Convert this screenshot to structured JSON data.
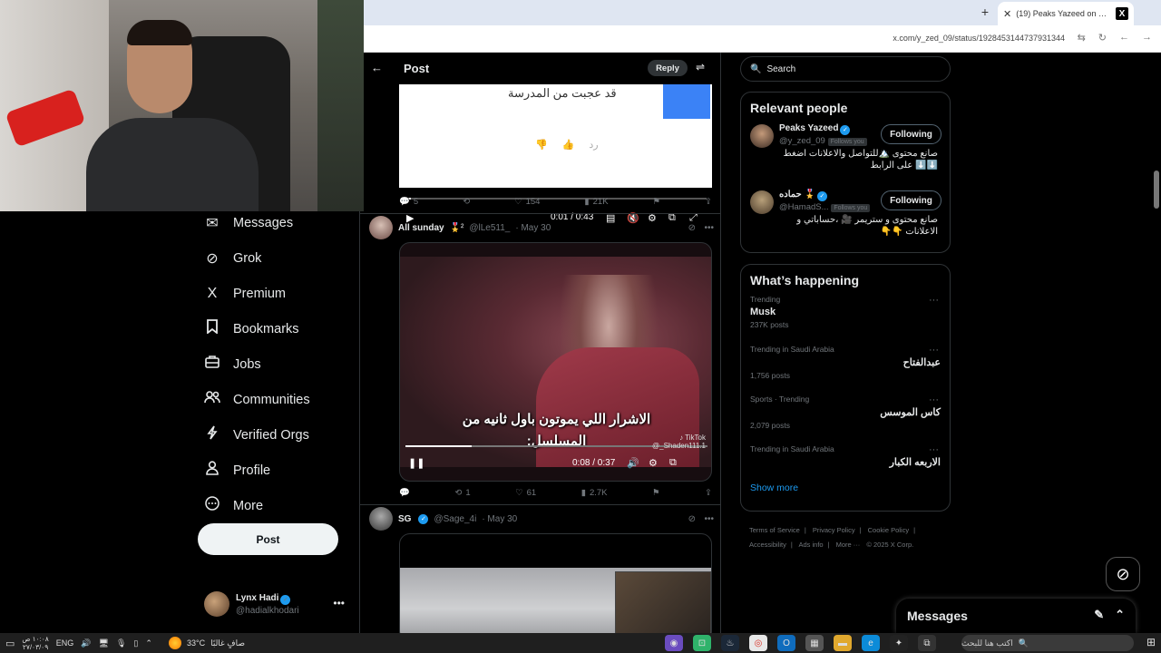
{
  "browser": {
    "tab_title": "(19) Peaks Yazeed on X: \"ا...",
    "tab_logo": "X",
    "new_tab": "+",
    "close": "✕",
    "url": "x.com/y_zed_09/status/1928453144737931344"
  },
  "nav": {
    "items": [
      {
        "label": "Messages",
        "icon": "envelope-icon",
        "glyph": "✉"
      },
      {
        "label": "Grok",
        "icon": "grok-icon",
        "glyph": "⊘"
      },
      {
        "label": "Premium",
        "icon": "x-icon",
        "glyph": "X"
      },
      {
        "label": "Bookmarks",
        "icon": "bookmark-icon",
        "glyph": "🔖"
      },
      {
        "label": "Jobs",
        "icon": "briefcase-icon",
        "glyph": "💼"
      },
      {
        "label": "Communities",
        "icon": "people-icon",
        "glyph": "👥"
      },
      {
        "label": "Verified Orgs",
        "icon": "lightning-icon",
        "glyph": "ϟ"
      },
      {
        "label": "Profile",
        "icon": "person-icon",
        "glyph": "👤"
      },
      {
        "label": "More",
        "icon": "more-circle-icon",
        "glyph": "⋯"
      }
    ],
    "post_button": "Post",
    "me": {
      "name": "Lynx Hadi",
      "handle": "@hadialkhodari"
    }
  },
  "post_header": {
    "title": "Post",
    "reply": "Reply",
    "back_glyph": "←"
  },
  "tweet1": {
    "video_text": "قد عجبت من المدرسة",
    "reply_text": "رد",
    "time": "0:01 / 0:43",
    "progress": 0.02,
    "stats": {
      "replies": "5",
      "retweets": "",
      "likes": "154",
      "views": "21K"
    }
  },
  "tweet2": {
    "name": "All sunday",
    "emoji": "🎖️²",
    "handle": "@lLe511_",
    "date": "· May 30",
    "subtitle_line1": "الاشرار اللي يموتون باول ثانيه من",
    "subtitle_line2": "المسلسل:",
    "tiktok": "TikTok",
    "tiktok_handle": "@_Shaden111.1",
    "time": "0:08 / 0:37",
    "progress": 0.22,
    "stats": {
      "replies": "",
      "retweets": "1",
      "likes": "61",
      "views": "2.7K"
    }
  },
  "tweet3": {
    "name": "SG",
    "handle": "@Sage_4i",
    "date": "· May 30"
  },
  "search": {
    "placeholder": "Search"
  },
  "relevant": {
    "title": "Relevant people",
    "people": [
      {
        "name": "Peaks Yazeed",
        "handle": "@y_zed_09",
        "follows_you": "Follows you",
        "button": "Following",
        "bio": "صانع محتوى 🏔️للتواصل والاعلانات اضغط ⬇️⬇️ على الرابط"
      },
      {
        "name": "حماده 🎖️",
        "handle": "@HamadS...",
        "follows_you": "Follows you",
        "button": "Following",
        "bio": "صانع محتوى و ستريمر 🎥 ،حساباتي و الاعلانات 👇👇"
      }
    ]
  },
  "happening": {
    "title": "What’s happening",
    "trends": [
      {
        "category": "Trending",
        "name": "Musk",
        "count": "237K posts",
        "rtl": false
      },
      {
        "category": "Trending in Saudi Arabia",
        "name": "عبدالفتاح",
        "count": "1,756 posts",
        "rtl": true
      },
      {
        "category": "Sports · Trending",
        "name": "كاس الموسس",
        "count": "2,079 posts",
        "rtl": true
      },
      {
        "category": "Trending in Saudi Arabia",
        "name": "الاربعه الكبار",
        "count": "",
        "rtl": true
      }
    ],
    "show_more": "Show more"
  },
  "footer": {
    "links": [
      "Terms of Service",
      "|",
      "Privacy Policy",
      "|",
      "Cookie Policy",
      "|",
      "Accessibility",
      "|",
      "Ads info",
      "|",
      "More ···",
      "© 2025 X Corp."
    ]
  },
  "messages_dock": {
    "title": "Messages"
  },
  "taskbar": {
    "lang": "ENG",
    "clock_line1": "١٠:٠٨ ص",
    "clock_line2": "٢٧/٠٣/٠٩",
    "temp": "33°C",
    "weather": "صافٍ غالبًا",
    "search_placeholder": "اكتب هنا للبحث"
  }
}
